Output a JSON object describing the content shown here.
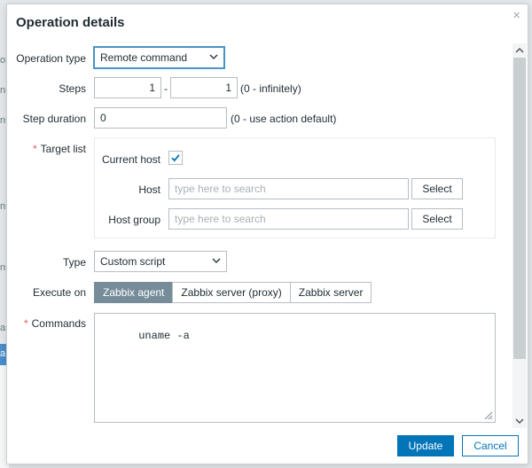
{
  "background": {
    "snippets": [
      "or",
      "ns",
      "ns",
      "ns",
      "ns",
      "as",
      "a"
    ]
  },
  "dialog": {
    "title": "Operation details",
    "close_glyph": "×"
  },
  "form": {
    "operation_type": {
      "label": "Operation type",
      "value": "Remote command"
    },
    "steps": {
      "label": "Steps",
      "from": "1",
      "separator": "-",
      "to": "1",
      "hint": "(0 - infinitely)"
    },
    "step_duration": {
      "label": "Step duration",
      "value": "0",
      "hint": "(0 - use action default)"
    },
    "target_list": {
      "required_mark": "*",
      "label": "Target list",
      "current_host": {
        "label": "Current host",
        "checked": true
      },
      "host": {
        "label": "Host",
        "placeholder": "type here to search",
        "button": "Select"
      },
      "host_group": {
        "label": "Host group",
        "placeholder": "type here to search",
        "button": "Select"
      }
    },
    "type": {
      "label": "Type",
      "value": "Custom script"
    },
    "execute_on": {
      "label": "Execute on",
      "options": [
        "Zabbix agent",
        "Zabbix server (proxy)",
        "Zabbix server"
      ],
      "selected": "Zabbix agent"
    },
    "commands": {
      "required_mark": "*",
      "label": "Commands",
      "value": "uname -a"
    }
  },
  "footer": {
    "update_label": "Update",
    "cancel_label": "Cancel"
  },
  "colors": {
    "primary": "#0275b8",
    "segment_active": "#768d99",
    "required": "#e45959",
    "checkbox_mark": "#0275b8"
  }
}
